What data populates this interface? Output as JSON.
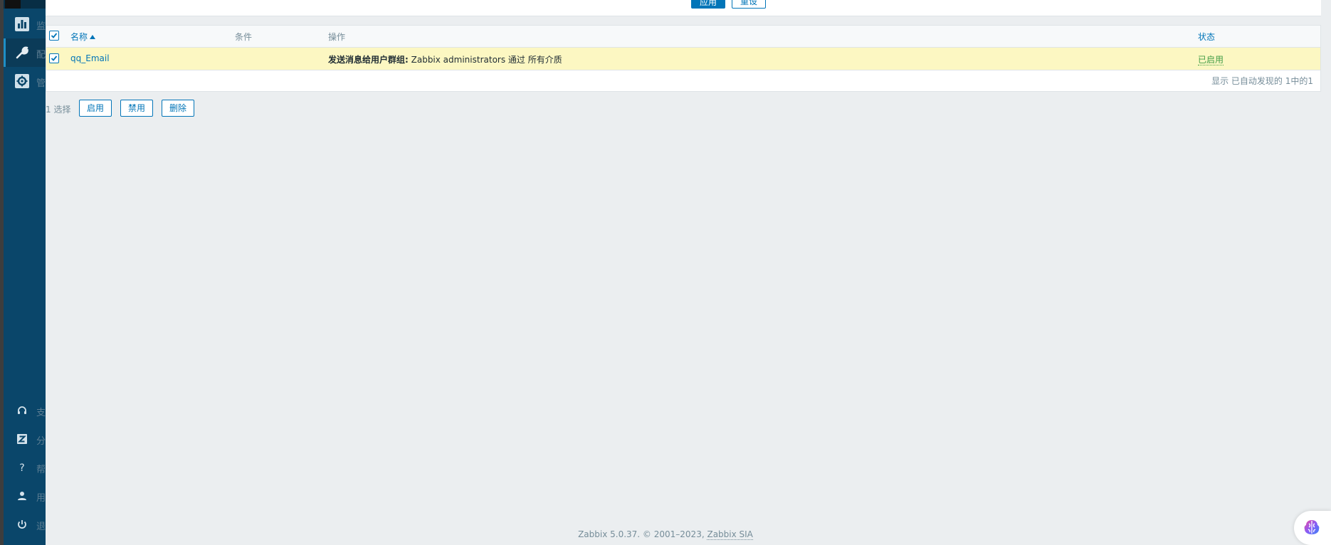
{
  "sidebar": {
    "items": [
      {
        "label": "监",
        "icon": "chart-icon",
        "active": false
      },
      {
        "label": "配",
        "icon": "wrench-icon",
        "active": true
      },
      {
        "label": "管",
        "icon": "gear-icon",
        "active": false
      }
    ],
    "bottom_items": [
      {
        "label": "支",
        "icon": "headset-icon"
      },
      {
        "label": "分",
        "icon": "zabbix-share-icon"
      },
      {
        "label": "帮",
        "icon": "help-icon"
      },
      {
        "label": "用",
        "icon": "user-icon"
      },
      {
        "label": "退",
        "icon": "power-icon"
      }
    ]
  },
  "filter": {
    "apply_label": "应用",
    "reset_label": "重设"
  },
  "table": {
    "columns": {
      "name": "名称",
      "conditions": "条件",
      "operations": "操作",
      "status": "状态"
    },
    "rows": [
      {
        "name": "qq_Email",
        "conditions": "",
        "operation_bold": "发送消息给用户群组:",
        "operation_text": " Zabbix administrators 通过 所有介质",
        "status": "已启用"
      }
    ],
    "footer": "显示 已自动发现的 1中的1"
  },
  "actions": {
    "selected_count": "1 选择",
    "enable_label": "启用",
    "disable_label": "禁用",
    "delete_label": "删除"
  },
  "footer": {
    "text": "Zabbix 5.0.37. © 2001–2023, ",
    "link": "Zabbix SIA"
  },
  "colors": {
    "sidebar": "#0a466a",
    "accent": "#0275b8",
    "row_highlight": "#fcf7c2",
    "status_enabled": "#429e47"
  }
}
